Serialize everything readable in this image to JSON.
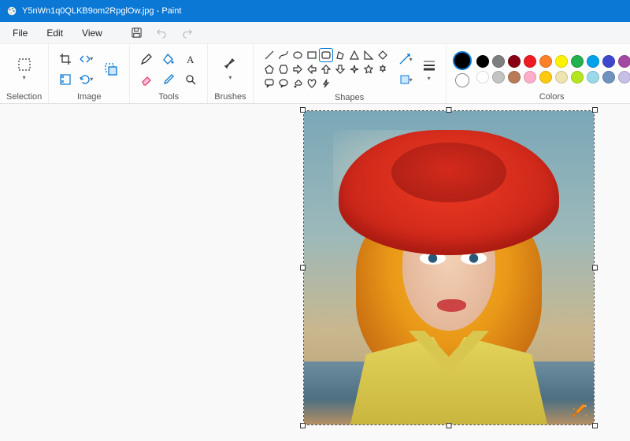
{
  "titlebar": {
    "title": "Y5nWn1q0QLKB9om2RpglOw.jpg - Paint"
  },
  "menu": {
    "file": "File",
    "edit": "Edit",
    "view": "View"
  },
  "ribbon": {
    "selection": "Selection",
    "image": "Image",
    "tools": "Tools",
    "brushes": "Brushes",
    "shapes": "Shapes",
    "colors": "Colors"
  },
  "colors": {
    "current": "#000000",
    "secondary": "#ffffff",
    "palette_row1": [
      "#000000",
      "#7f7f7f",
      "#880015",
      "#ed1c24",
      "#ff7f27",
      "#fff200",
      "#22b14c",
      "#00a2e8",
      "#3f48cc",
      "#a349a4"
    ],
    "palette_row2": [
      "#ffffff",
      "#c3c3c3",
      "#b97a57",
      "#ffaec9",
      "#ffc90e",
      "#efe4b0",
      "#b5e61d",
      "#99d9ea",
      "#7092be",
      "#c8bfe7"
    ]
  },
  "shapes": {
    "selected_index": 4
  }
}
